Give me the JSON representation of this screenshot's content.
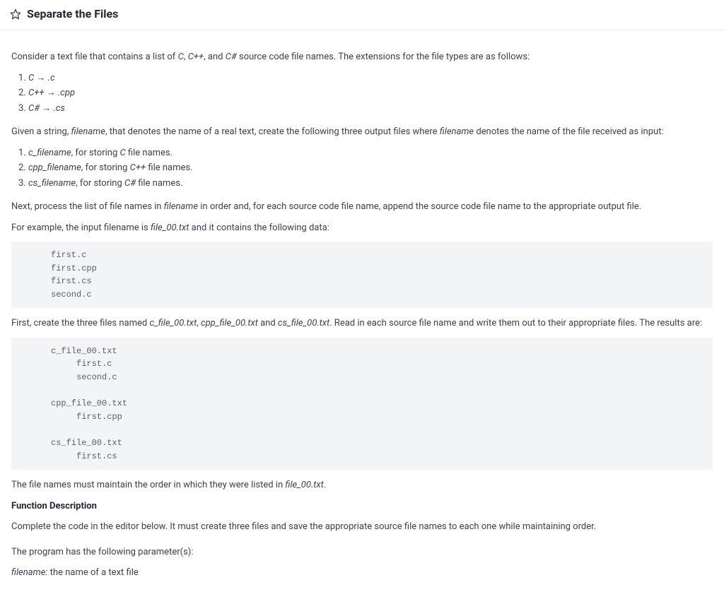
{
  "header": {
    "title": "Separate the Files"
  },
  "intro": {
    "line1_pre": "Consider a text file that contains a list of ",
    "c": "C",
    "comma1": ", ",
    "cpp": "C++",
    "comma2": ", and ",
    "csharp": "C#",
    "line1_post": " source code file names. The extensions for the file types are as follows:"
  },
  "extlist": [
    {
      "lang": "C",
      "arrow": " → ",
      "ext": ".c"
    },
    {
      "lang": "C++",
      "arrow": " → ",
      "ext": ".cpp"
    },
    {
      "lang": "C#",
      "arrow": " → ",
      "ext": ".cs"
    }
  ],
  "given": {
    "pre": "Given a string, ",
    "filename": "filename",
    "mid": ", that denotes the name of a real text, create the following three output files where ",
    "filename2": "filename",
    "post": " denotes the name of the file received as input:"
  },
  "outfiles": [
    {
      "prefix": "c_filename",
      "sep": ", for storing ",
      "lang": "C",
      "tail": " file names."
    },
    {
      "prefix": "cpp_filename",
      "sep": ", for storing ",
      "lang": "C++",
      "tail": " file names."
    },
    {
      "prefix": "cs_filename",
      "sep": ", for storing ",
      "lang": "C#",
      "tail": " file names."
    }
  ],
  "next_p": {
    "pre": "Next, process the list of file names in ",
    "fn": "filename",
    "post": " in order and, for each source code file name, append the source code file name to the appropriate output file."
  },
  "example_intro": {
    "pre": "For example, the input filename is ",
    "fn": "file_00.txt",
    "post": " and it contains the following data:"
  },
  "code1": "first.c\nfirst.cpp\nfirst.cs\nsecond.c",
  "mid_p": {
    "pre": "First, create the three files named ",
    "f1": "c_file_00.txt",
    "c1": ", ",
    "f2": "cpp_file_00.txt",
    "c2": " and ",
    "f3": "cs_file_00.txt",
    "post": ". Read in each source file name and write them out to their appropriate files. The results are:"
  },
  "code2": "c_file_00.txt\n     first.c\n     second.c\n\ncpp_file_00.txt\n     first.cpp\n\ncs_file_00.txt\n     first.cs",
  "order_p": {
    "pre": "The file names must maintain the order in which they were listed in ",
    "fn": "file_00.txt",
    "post": "."
  },
  "fn_desc_title": "Function Description",
  "fn_desc_body": "Complete the code in the editor below. It must create three files and save the appropriate source file names to each one while maintaining order.",
  "params_intro": "The program has the following parameter(s):",
  "param": {
    "name": "filename:",
    "desc": "  the name of a text file"
  }
}
